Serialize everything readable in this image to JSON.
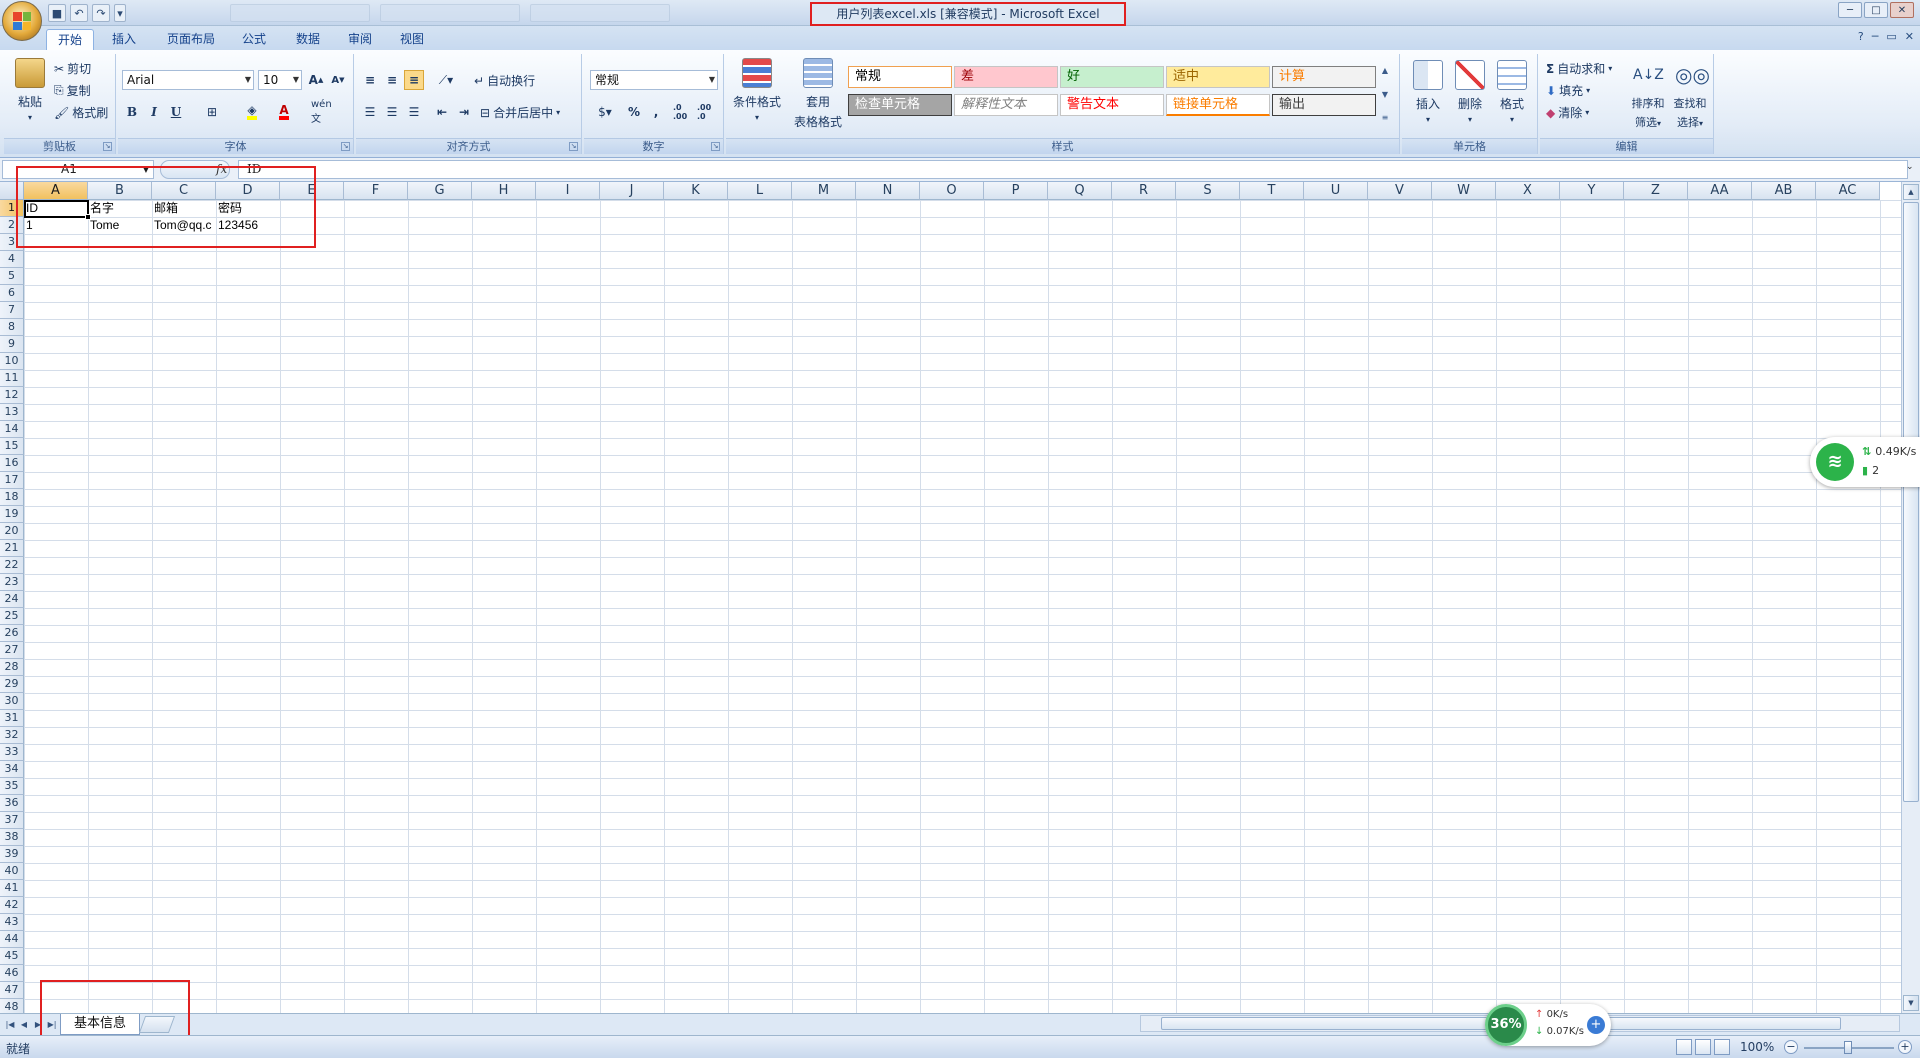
{
  "window": {
    "title": "用户列表excel.xls  [兼容模式] - Microsoft Excel"
  },
  "ribbon_tabs": [
    {
      "label": "开始",
      "active": true
    },
    {
      "label": "插入"
    },
    {
      "label": "页面布局"
    },
    {
      "label": "公式"
    },
    {
      "label": "数据"
    },
    {
      "label": "审阅"
    },
    {
      "label": "视图"
    }
  ],
  "clipboard": {
    "group_label": "剪贴板",
    "paste": "粘贴",
    "cut": "剪切",
    "copy": "复制",
    "format_painter": "格式刷"
  },
  "font": {
    "group_label": "字体",
    "family": "Arial",
    "size": "10",
    "bold": "B",
    "italic": "I",
    "underline": "U",
    "phonetic": "wén 文"
  },
  "alignment": {
    "group_label": "对齐方式",
    "wrap_text": "自动换行",
    "merge_center": "合并后居中"
  },
  "number": {
    "group_label": "数字",
    "format": "常规",
    "percent": "%",
    "comma": ",",
    "inc_decimal": ".0 .00",
    "dec_decimal": ".00 .0"
  },
  "styles": {
    "group_label": "样式",
    "conditional_format": "条件格式",
    "format_as_table_1": "套用",
    "format_as_table_2": "表格格式",
    "cells": [
      {
        "label": "常规",
        "bg": "#ffffff",
        "color": "#000000",
        "border": "#f0a050"
      },
      {
        "label": "差",
        "bg": "#ffc7ce",
        "color": "#9c0006"
      },
      {
        "label": "好",
        "bg": "#c6efce",
        "color": "#006100"
      },
      {
        "label": "适中",
        "bg": "#ffeb9c",
        "color": "#9c6500"
      },
      {
        "label": "计算",
        "bg": "#f2f2f2",
        "color": "#fa7d00",
        "border": "#7f7f7f"
      },
      {
        "label": "检查单元格",
        "bg": "#a5a5a5",
        "color": "#ffffff",
        "border": "#3f3f3f"
      },
      {
        "label": "解释性文本",
        "bg": "#ffffff",
        "color": "#7f7f7f"
      },
      {
        "label": "警告文本",
        "bg": "#ffffff",
        "color": "#ff0000"
      },
      {
        "label": "链接单元格",
        "bg": "#ffffff",
        "color": "#fa7d00"
      },
      {
        "label": "输出",
        "bg": "#f2f2f2",
        "color": "#3f3f3f",
        "border": "#3f3f3f"
      }
    ]
  },
  "cells_group": {
    "group_label": "单元格",
    "insert": "插入",
    "delete": "删除",
    "format": "格式"
  },
  "editing": {
    "group_label": "编辑",
    "autosum": "自动求和",
    "fill": "填充",
    "clear": "清除",
    "sort_filter_1": "排序和",
    "sort_filter_2": "筛选",
    "find_select_1": "查找和",
    "find_select_2": "选择"
  },
  "formula_bar": {
    "name_box": "A1",
    "fx": "fx",
    "value": "ID"
  },
  "sheet": {
    "columns": [
      "A",
      "B",
      "C",
      "D",
      "E",
      "F",
      "G",
      "H",
      "I",
      "J",
      "K",
      "L",
      "M",
      "N",
      "O",
      "P",
      "Q",
      "R",
      "S",
      "T",
      "U",
      "V",
      "W",
      "X",
      "Y",
      "Z",
      "AA",
      "AB",
      "AC"
    ],
    "row_count": 48,
    "selected_column": "A",
    "selected_row": 1,
    "data": [
      [
        "ID",
        "名字",
        "邮箱",
        "密码"
      ],
      [
        "1",
        "Tome",
        "Tom@qq.c",
        "123456"
      ]
    ],
    "tab_name": "基本信息"
  },
  "status": {
    "ready": "就绪",
    "zoom": "100%"
  },
  "net_widget": {
    "speed": "0.49K/s",
    "count": "2"
  },
  "speed_widget": {
    "percent": "36%",
    "up": "0K/s",
    "down": "0.07K/s"
  },
  "colors": {
    "accent_red": "#e02020",
    "ribbon_blue": "#15428b",
    "selection_orange": "#f1c15f"
  }
}
